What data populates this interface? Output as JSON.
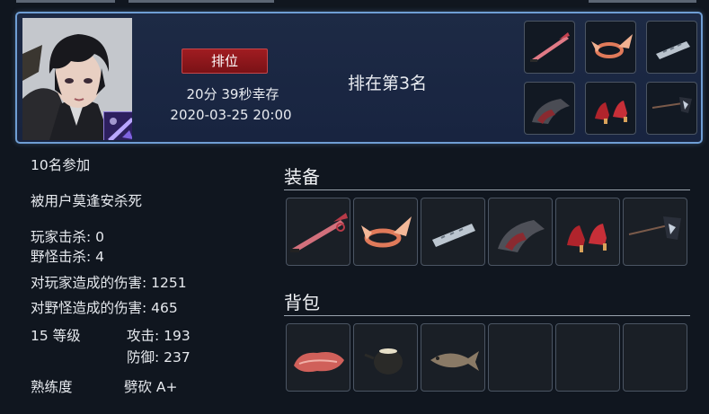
{
  "header": {
    "rank_label": "排位",
    "survive_time": "20分 39秒幸存",
    "date": "2020-03-25 20:00",
    "placement": "排在第3名",
    "equipped_icons": [
      "sword-icon",
      "winged-circlet-icon",
      "bracer-icon",
      "gauntlet-icon",
      "red-heels-icon",
      "flag-spear-icon"
    ]
  },
  "stats": {
    "participants": "10名参加",
    "killed_by": "被用户莫逢安杀死",
    "player_kills": "玩家击杀: 0",
    "monster_kills": "野怪击杀: 4",
    "player_damage": "对玩家造成的伤害: 1251",
    "monster_damage": "对野怪造成的伤害: 465",
    "level": "15 等级",
    "attack": "攻击: 193",
    "defense": "防御: 237",
    "proficiency_label": "熟练度",
    "proficiency_value": "劈砍 A+"
  },
  "equipment": {
    "title": "装备",
    "icons": [
      "sword-icon",
      "winged-circlet-icon",
      "bracer-icon",
      "gauntlet-icon",
      "red-heels-icon",
      "flag-spear-icon"
    ]
  },
  "backpack": {
    "title": "背包",
    "icons": [
      "meat-icon",
      "pot-icon",
      "fish-icon",
      "empty-slot",
      "empty-slot",
      "empty-slot"
    ]
  },
  "colors": {
    "accent_border": "#6f9ed4",
    "rank_badge": "#a01c21",
    "card_bg": "#1d2a45",
    "page_bg": "#10161f"
  }
}
